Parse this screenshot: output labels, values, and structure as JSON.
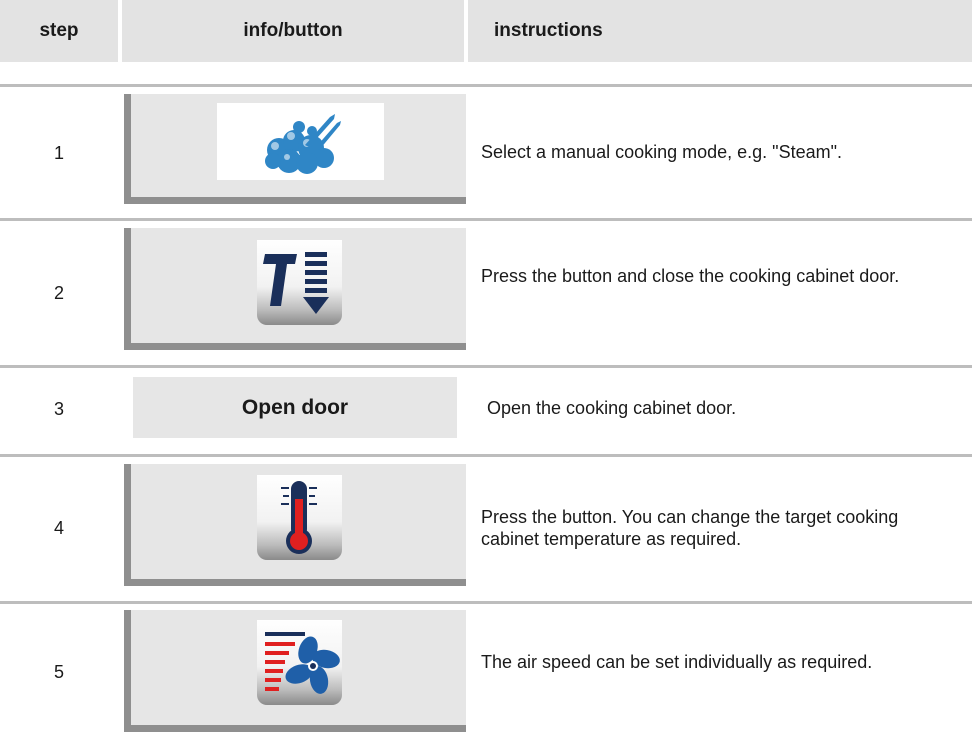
{
  "header": {
    "step": "step",
    "info": "info/button",
    "instructions": "instructions"
  },
  "rows": [
    {
      "step": "1",
      "icon": "steam-mode-icon",
      "text": "Select a manual cooking mode, e.g. \"Steam\"."
    },
    {
      "step": "2",
      "icon": "preheat-temperature-down-icon",
      "text": "Press the button and close the cooking cabinet door."
    },
    {
      "step": "3",
      "info_label": "Open door",
      "text": "Open the cooking cabinet door."
    },
    {
      "step": "4",
      "icon": "thermometer-icon",
      "text": "Press the button. You can change the target cooking cabinet temperature as required."
    },
    {
      "step": "5",
      "icon": "fan-speed-icon",
      "text": "The air speed can be set individually as required."
    }
  ],
  "colors": {
    "header_bg": "#e3e3e3",
    "panel_bg": "#e6e6e6",
    "shadow": "#8f8f8f",
    "steam_blue": "#2f86c6",
    "therm_red": "#e02020",
    "fan_blue": "#1f5fa8",
    "navy": "#1a2f5a"
  }
}
